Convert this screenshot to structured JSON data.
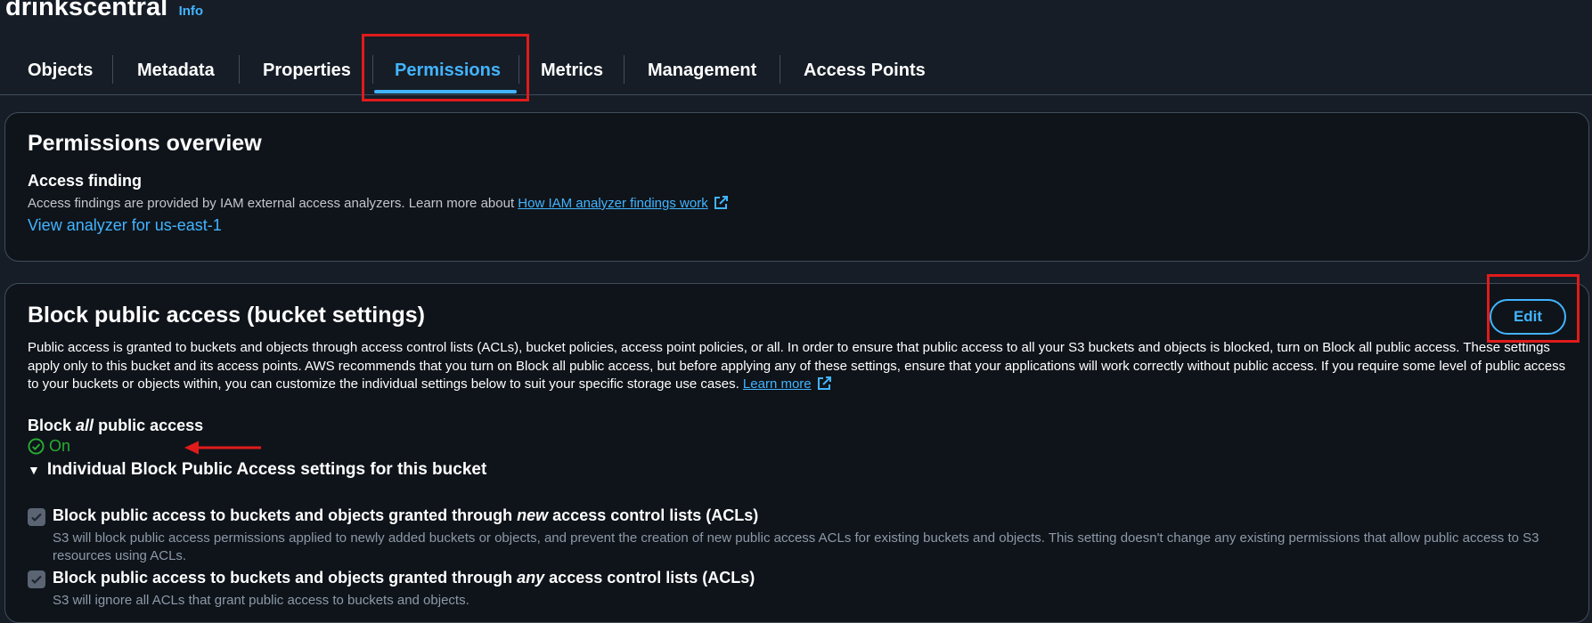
{
  "header": {
    "bucket_name": "drinkscentral",
    "info_label": "Info"
  },
  "tabs": [
    {
      "label": "Objects"
    },
    {
      "label": "Metadata"
    },
    {
      "label": "Properties"
    },
    {
      "label": "Permissions",
      "active": true
    },
    {
      "label": "Metrics"
    },
    {
      "label": "Management"
    },
    {
      "label": "Access Points"
    }
  ],
  "permissions_overview": {
    "title": "Permissions overview",
    "access_finding_label": "Access finding",
    "description": "Access findings are provided by IAM external access analyzers. Learn more about",
    "link_text": "How IAM analyzer findings work",
    "analyzer_link": "View analyzer for us-east-1"
  },
  "block_public_access": {
    "title": "Block public access (bucket settings)",
    "edit_label": "Edit",
    "description": "Public access is granted to buckets and objects through access control lists (ACLs), bucket policies, access point policies, or all. In order to ensure that public access to all your S3 buckets and objects is blocked, turn on Block all public access. These settings apply only to this bucket and its access points. AWS recommends that you turn on Block all public access, but before applying any of these settings, ensure that your applications will work correctly without public access. If you require some level of public access to your buckets or objects within, you can customize the individual settings below to suit your specific storage use cases.",
    "learn_more": "Learn more",
    "block_all_prefix": "Block",
    "block_all_emph": "all",
    "block_all_suffix": "public access",
    "status": "On",
    "individual_header": "Individual Block Public Access settings for this bucket",
    "settings": [
      {
        "title_prefix": "Block public access to buckets and objects granted through",
        "title_emph": "new",
        "title_suffix": "access control lists (ACLs)",
        "description": "S3 will block public access permissions applied to newly added buckets or objects, and prevent the creation of new public access ACLs for existing buckets and objects. This setting doesn't change any existing permissions that allow public access to S3 resources using ACLs."
      },
      {
        "title_prefix": "Block public access to buckets and objects granted through",
        "title_emph": "any",
        "title_suffix": "access control lists (ACLs)",
        "description": "S3 will ignore all ACLs that grant public access to buckets and objects."
      }
    ]
  },
  "colors": {
    "accent": "#42b4ff",
    "success": "#29ad32",
    "annotation": "#e01b1b",
    "background": "#161d26"
  }
}
